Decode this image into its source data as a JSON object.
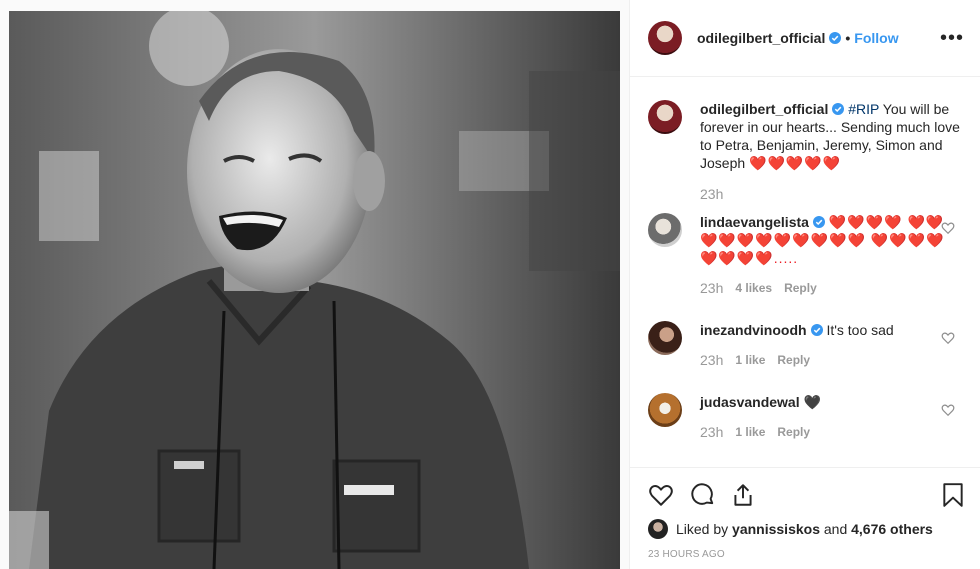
{
  "post": {
    "author": "odilegilbert_official",
    "follow_label": "Follow",
    "separator": "•",
    "more_label": "•••"
  },
  "comments": [
    {
      "user": "odilegilbert_official",
      "hashtag": "#RIP",
      "text": " You will be forever in our hearts... Sending much love to Petra, Benjamin, Jeremy, Simon and Joseph ",
      "emoji": "❤️❤️❤️❤️❤️",
      "time": "23h"
    },
    {
      "user": "lindaevangelista",
      "emoji": "❤️❤️❤️❤️ ❤️❤️❤️❤️❤️❤️❤️❤️❤️❤️❤️ ❤️❤️❤️❤️❤️❤️❤️❤️.....",
      "time": "23h",
      "likes": "4 likes",
      "reply": "Reply"
    },
    {
      "user": "inezandvinoodh",
      "text": " It's too sad",
      "time": "23h",
      "likes": "1 like",
      "reply": "Reply"
    },
    {
      "user": "judasvandewal",
      "emoji": "🖤",
      "time": "23h",
      "likes": "1 like",
      "reply": "Reply"
    }
  ],
  "footer": {
    "liked_prefix": "Liked by ",
    "liked_user": "yannissiskos",
    "liked_mid": " and ",
    "liked_count": "4,676 others",
    "timestamp": "23 HOURS AGO"
  },
  "colors": {
    "link": "#3897f0",
    "verified": "#3897f0",
    "heart": "#ed1c24"
  }
}
